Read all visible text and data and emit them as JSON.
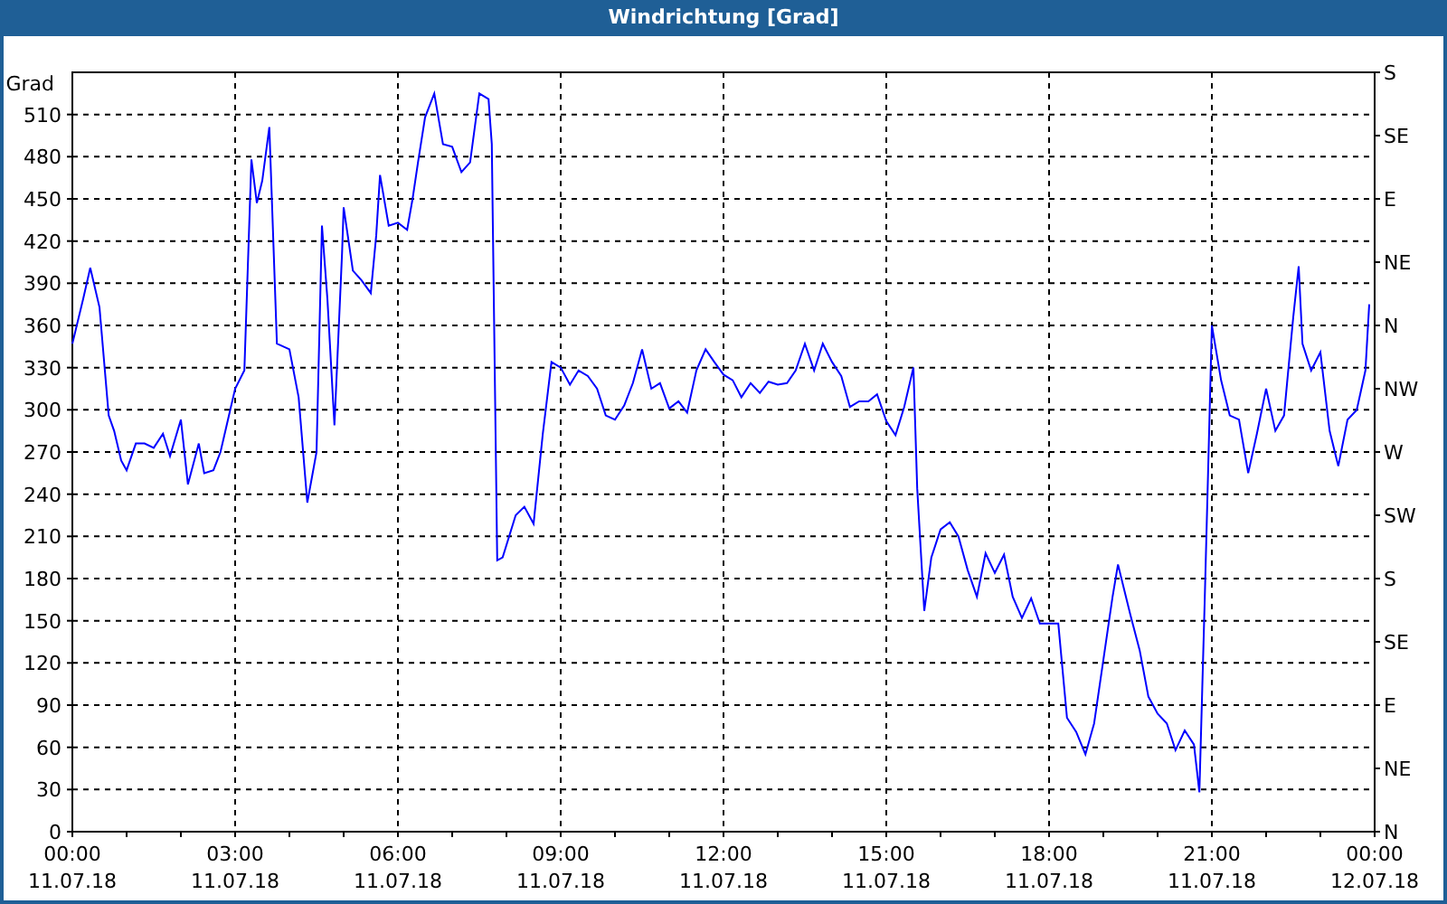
{
  "window": {
    "title": "Windrichtung [Grad]"
  },
  "chart": {
    "chart_data": {
      "type": "line",
      "ylabel": "Grad",
      "x": [
        0,
        0.2,
        0.33,
        0.5,
        0.67,
        0.77,
        0.9,
        1,
        1.17,
        1.33,
        1.5,
        1.67,
        1.8,
        2,
        2.13,
        2.33,
        2.43,
        2.6,
        2.73,
        3,
        3.17,
        3.3,
        3.4,
        3.5,
        3.63,
        3.77,
        4,
        4.17,
        4.33,
        4.5,
        4.6,
        4.7,
        4.83,
        4.97,
        5,
        5.17,
        5.33,
        5.5,
        5.6,
        5.67,
        5.83,
        6,
        6.17,
        6.27,
        6.37,
        6.5,
        6.67,
        6.83,
        7,
        7.17,
        7.33,
        7.5,
        7.67,
        7.73,
        7.83,
        7.93,
        8.17,
        8.33,
        8.5,
        8.67,
        8.83,
        9,
        9.17,
        9.33,
        9.5,
        9.67,
        9.83,
        10,
        10.17,
        10.33,
        10.5,
        10.67,
        10.83,
        11,
        11.17,
        11.33,
        11.5,
        11.67,
        11.83,
        12,
        12.17,
        12.33,
        12.5,
        12.67,
        12.83,
        13,
        13.17,
        13.33,
        13.5,
        13.67,
        13.83,
        14,
        14.17,
        14.33,
        14.5,
        14.67,
        14.83,
        15,
        15.17,
        15.33,
        15.5,
        15.57,
        15.7,
        15.83,
        16,
        16.17,
        16.33,
        16.5,
        16.67,
        16.83,
        17,
        17.17,
        17.33,
        17.5,
        17.67,
        17.83,
        18,
        18.17,
        18.33,
        18.5,
        18.67,
        18.83,
        19,
        19.17,
        19.27,
        19.5,
        19.67,
        19.83,
        20,
        20.17,
        20.33,
        20.5,
        20.67,
        20.77,
        20.87,
        20.93,
        21,
        21.17,
        21.33,
        21.5,
        21.67,
        21.83,
        22,
        22.17,
        22.33,
        22.5,
        22.6,
        22.67,
        22.83,
        23,
        23.17,
        23.33,
        23.5,
        23.67,
        23.83,
        23.9
      ],
      "grid": true,
      "series": [
        {
          "color": "#0000ff",
          "values": [
            347,
            379,
            401,
            373,
            296,
            285,
            264,
            257,
            276,
            276,
            273,
            283,
            267,
            293,
            247,
            276,
            255,
            257,
            270,
            315,
            328,
            478,
            447,
            463,
            501,
            347,
            343,
            309,
            234,
            270,
            431,
            379,
            289,
            411,
            444,
            399,
            392,
            383,
            424,
            467,
            431,
            433,
            428,
            450,
            476,
            508,
            525,
            489,
            487,
            469,
            476,
            525,
            521,
            489,
            193,
            195,
            225,
            231,
            219,
            283,
            334,
            330,
            318,
            328,
            324,
            315,
            296,
            293,
            303,
            319,
            343,
            315,
            319,
            301,
            306,
            298,
            328,
            343,
            334,
            325,
            321,
            309,
            319,
            312,
            320,
            318,
            319,
            328,
            347,
            328,
            347,
            334,
            324,
            302,
            306,
            306,
            311,
            292,
            282,
            302,
            330,
            244,
            157,
            195,
            215,
            220,
            210,
            186,
            167,
            198,
            184,
            197,
            167,
            152,
            166,
            148,
            148,
            148,
            81,
            71,
            55,
            77,
            122,
            167,
            190,
            154,
            129,
            96,
            84,
            77,
            58,
            72,
            62,
            28,
            167,
            255,
            360,
            321,
            296,
            293,
            255,
            283,
            315,
            285,
            296,
            366,
            402,
            347,
            328,
            341,
            285,
            260,
            293,
            300,
            328,
            375
          ]
        }
      ],
      "xlim": [
        0,
        24
      ],
      "ylim": [
        0,
        540
      ],
      "xticks": [
        {
          "value": 0,
          "label": "00:00"
        },
        {
          "value": 3,
          "label": "03:00"
        },
        {
          "value": 6,
          "label": "06:00"
        },
        {
          "value": 9,
          "label": "09:00"
        },
        {
          "value": 12,
          "label": "12:00"
        },
        {
          "value": 15,
          "label": "15:00"
        },
        {
          "value": 18,
          "label": "18:00"
        },
        {
          "value": 21,
          "label": "21:00"
        },
        {
          "value": 24,
          "label": "00:00"
        }
      ],
      "yticks": [
        0,
        30,
        60,
        90,
        120,
        150,
        180,
        210,
        240,
        270,
        300,
        330,
        360,
        390,
        420,
        450,
        480,
        510
      ]
    },
    "x_axis_dates": [
      "11.07.18",
      "11.07.18",
      "11.07.18",
      "11.07.18",
      "11.07.18",
      "11.07.18",
      "11.07.18",
      "11.07.18",
      "12.07.18"
    ],
    "right_axis_labels": [
      "S",
      "SE",
      "E",
      "NE",
      "N",
      "NW",
      "W",
      "SW",
      "S",
      "SE",
      "E",
      "NE",
      "N"
    ]
  }
}
